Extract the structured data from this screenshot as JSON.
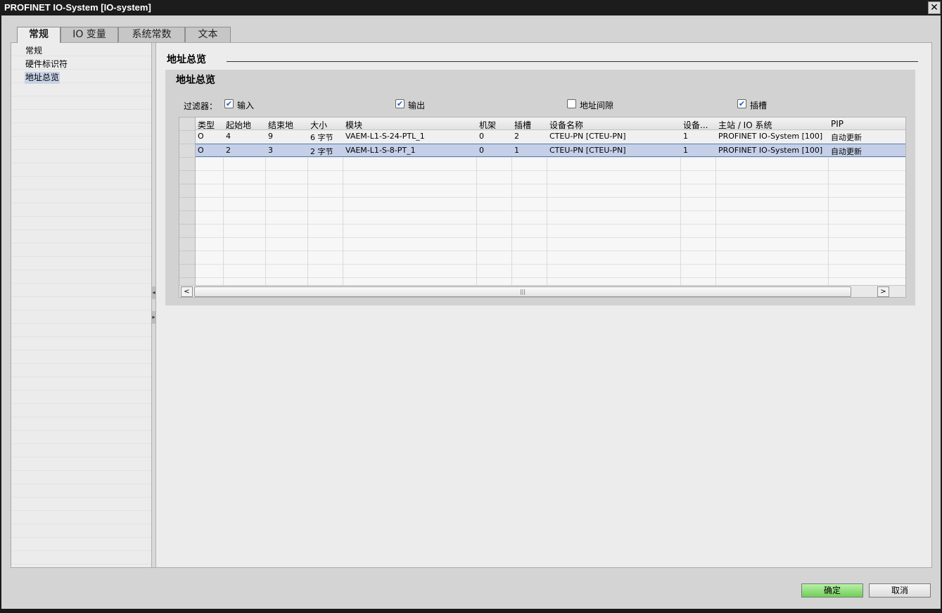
{
  "window": {
    "title": "PROFINET IO-System [IO-system]",
    "close_glyph": "✕"
  },
  "tabs": [
    {
      "label": "常规",
      "active": true
    },
    {
      "label": "IO 变量",
      "active": false
    },
    {
      "label": "系统常数",
      "active": false
    },
    {
      "label": "文本",
      "active": false
    }
  ],
  "nav": {
    "items": [
      {
        "label": "常规",
        "selected": false
      },
      {
        "label": "硬件标识符",
        "selected": false
      },
      {
        "label": "地址总览",
        "selected": true
      }
    ]
  },
  "section": {
    "title": "地址总览"
  },
  "address_overview": {
    "title": "地址总览",
    "filter_label": "过滤器：",
    "filters": [
      {
        "label": "输入",
        "checked": true
      },
      {
        "label": "输出",
        "checked": true
      },
      {
        "label": "地址间隙",
        "checked": false
      },
      {
        "label": "插槽",
        "checked": true
      }
    ],
    "columns": [
      "类型",
      "起始地",
      "结束地",
      "大小",
      "模块",
      "机架",
      "插槽",
      "设备名称",
      "设备...",
      "主站 / IO 系统",
      "PIP"
    ],
    "rows": [
      [
        "O",
        "4",
        "9",
        "6 字节",
        "VAEM-L1-S-24-PTL_1",
        "0",
        "2",
        "CTEU-PN [CTEU-PN]",
        "1",
        "PROFINET IO-System [100]",
        "自动更新"
      ],
      [
        "O",
        "2",
        "3",
        "2 字节",
        "VAEM-L1-S-8-PT_1",
        "0",
        "1",
        "CTEU-PN [CTEU-PN]",
        "1",
        "PROFINET IO-System [100]",
        "自动更新"
      ]
    ],
    "selected_row": 1,
    "scroll_left": "<",
    "scroll_right": ">",
    "scroll_grip": "|||"
  },
  "buttons": {
    "ok": "确定",
    "cancel": "取消"
  },
  "colors": {
    "accent": "#6fcf57",
    "selection": "#c5d0e8",
    "titlebar": "#1c1c1c"
  },
  "icons": [
    "close-icon",
    "check-icon",
    "chevron-left-icon",
    "chevron-right-icon",
    "resize-grip-icon"
  ]
}
